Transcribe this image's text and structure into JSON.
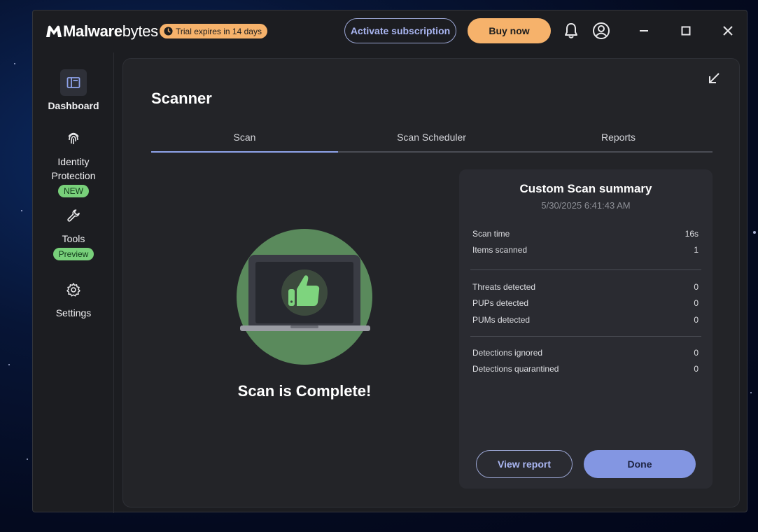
{
  "app": {
    "logo_bold": "Malware",
    "logo_light": "bytes",
    "trial_badge": "Trial expires in 14 days",
    "activate_label": "Activate subscription",
    "buy_label": "Buy now"
  },
  "sidebar": {
    "items": [
      {
        "label": "Dashboard",
        "icon": "dashboard-icon",
        "active": true
      },
      {
        "label_line1": "Identity",
        "label_line2": "Protection",
        "icon": "fingerprint-icon",
        "badge": "NEW"
      },
      {
        "label": "Tools",
        "icon": "wrench-icon",
        "badge": "Preview"
      },
      {
        "label": "Settings",
        "icon": "gear-icon"
      }
    ]
  },
  "scanner": {
    "title": "Scanner",
    "tabs": [
      "Scan",
      "Scan Scheduler",
      "Reports"
    ],
    "active_tab": "Scan",
    "status": "Scan is Complete!"
  },
  "summary": {
    "title": "Custom Scan summary",
    "date": "5/30/2025 6:41:43 AM",
    "rows": [
      {
        "label": "Scan time",
        "value": "16s"
      },
      {
        "label": "Items scanned",
        "value": "1"
      },
      {
        "label": "Threats detected",
        "value": "0"
      },
      {
        "label": "PUPs detected",
        "value": "0"
      },
      {
        "label": "PUMs detected",
        "value": "0"
      },
      {
        "label": "Detections ignored",
        "value": "0"
      },
      {
        "label": "Detections quarantined",
        "value": "0"
      }
    ],
    "view_report_label": "View report",
    "done_label": "Done"
  },
  "colors": {
    "accent_orange": "#f6b26b",
    "accent_blue": "#8396e2",
    "badge_green": "#78d07a",
    "illustration_green": "#5a8a5c"
  }
}
